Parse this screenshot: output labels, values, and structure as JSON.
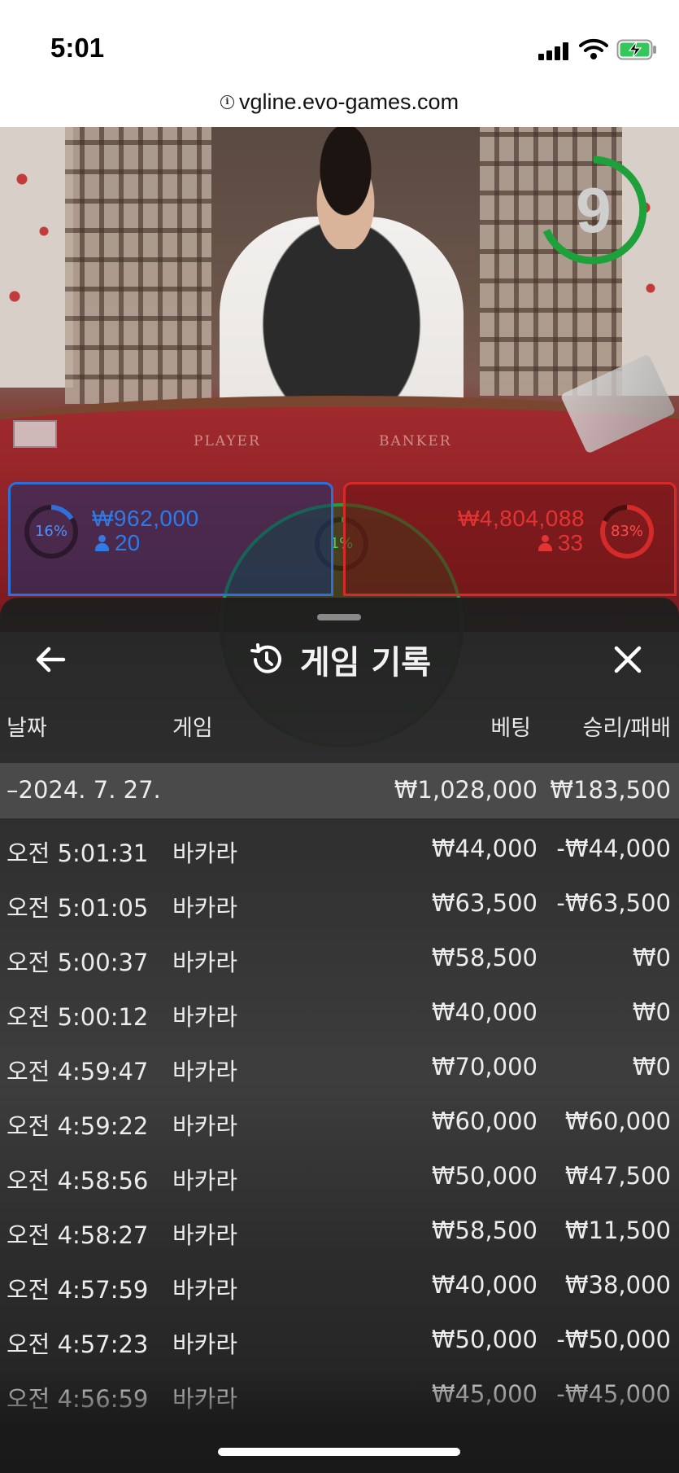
{
  "status_bar": {
    "time": "5:01"
  },
  "browser": {
    "url": "vgline.evo-games.com"
  },
  "video": {
    "countdown": "9",
    "table_labels": [
      "PLAYER",
      "BANKER"
    ]
  },
  "bets": {
    "player": {
      "percent": "16%",
      "amount": "₩962,000",
      "players": "20",
      "color": "#2f6fd6"
    },
    "tie": {
      "percent": "1%",
      "color": "#1ea03a"
    },
    "banker": {
      "percent": "83%",
      "amount": "₩4,804,088",
      "players": "33",
      "color": "#d42a2a"
    }
  },
  "sheet": {
    "title": "게임 기록",
    "columns": {
      "date": "날짜",
      "game": "게임",
      "bet": "베팅",
      "result": "승리/패배"
    },
    "day": {
      "label": "–2024. 7. 27.",
      "bet_total": "₩1,028,000",
      "result_total": "₩183,500"
    },
    "rows": [
      {
        "time": "오전 5:01:31",
        "game": "바카라",
        "bet": "₩44,000",
        "result": "-₩44,000"
      },
      {
        "time": "오전 5:01:05",
        "game": "바카라",
        "bet": "₩63,500",
        "result": "-₩63,500"
      },
      {
        "time": "오전 5:00:37",
        "game": "바카라",
        "bet": "₩58,500",
        "result": "₩0"
      },
      {
        "time": "오전 5:00:12",
        "game": "바카라",
        "bet": "₩40,000",
        "result": "₩0"
      },
      {
        "time": "오전 4:59:47",
        "game": "바카라",
        "bet": "₩70,000",
        "result": "₩0"
      },
      {
        "time": "오전 4:59:22",
        "game": "바카라",
        "bet": "₩60,000",
        "result": "₩60,000"
      },
      {
        "time": "오전 4:58:56",
        "game": "바카라",
        "bet": "₩50,000",
        "result": "₩47,500"
      },
      {
        "time": "오전 4:58:27",
        "game": "바카라",
        "bet": "₩58,500",
        "result": "₩11,500"
      },
      {
        "time": "오전 4:57:59",
        "game": "바카라",
        "bet": "₩40,000",
        "result": "₩38,000"
      },
      {
        "time": "오전 4:57:23",
        "game": "바카라",
        "bet": "₩50,000",
        "result": "-₩50,000"
      },
      {
        "time": "오전 4:56:59",
        "game": "바카라",
        "bet": "₩45,000",
        "result": "-₩45,000"
      }
    ]
  },
  "icons": [
    "info-icon",
    "signal-icon",
    "wifi-icon",
    "battery-charging-icon",
    "back-arrow-icon",
    "history-icon",
    "close-icon",
    "person-icon"
  ]
}
